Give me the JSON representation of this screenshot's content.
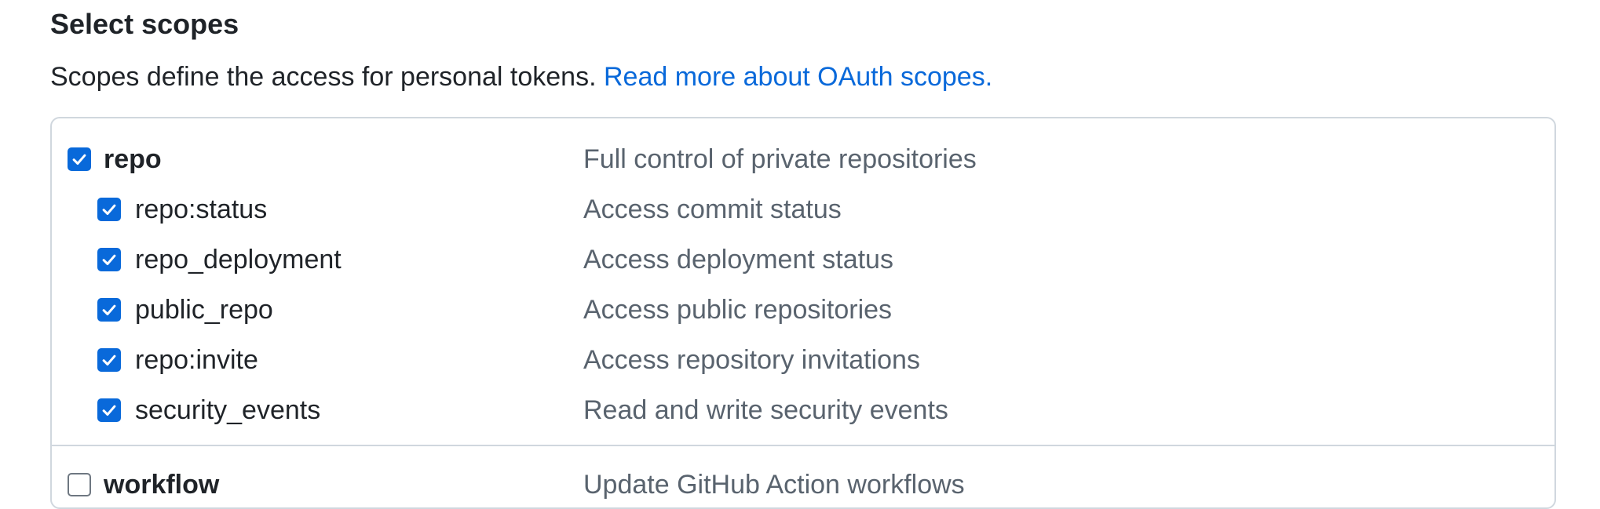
{
  "section": {
    "title": "Select scopes",
    "description": "Scopes define the access for personal tokens.",
    "link_text": "Read more about OAuth scopes."
  },
  "scopes": {
    "repo": {
      "name": "repo",
      "description": "Full control of private repositories",
      "checked": true,
      "children": [
        {
          "name": "repo:status",
          "description": "Access commit status",
          "checked": true
        },
        {
          "name": "repo_deployment",
          "description": "Access deployment status",
          "checked": true
        },
        {
          "name": "public_repo",
          "description": "Access public repositories",
          "checked": true
        },
        {
          "name": "repo:invite",
          "description": "Access repository invitations",
          "checked": true
        },
        {
          "name": "security_events",
          "description": "Read and write security events",
          "checked": true
        }
      ]
    },
    "workflow": {
      "name": "workflow",
      "description": "Update GitHub Action workflows",
      "checked": false
    }
  },
  "colors": {
    "accent": "#0969da",
    "border": "#d0d7de",
    "muted_text": "#59636e"
  }
}
